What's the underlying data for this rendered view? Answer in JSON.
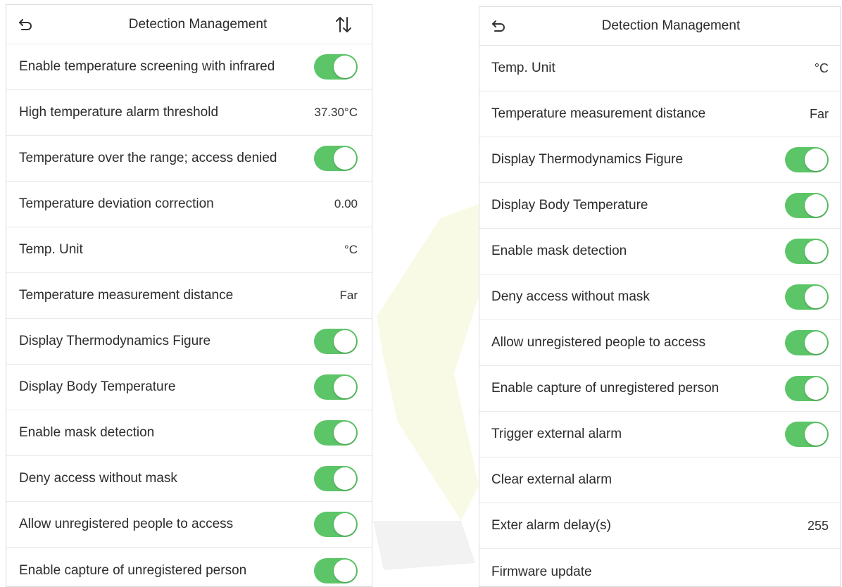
{
  "colors": {
    "toggle_on": "#5cc567",
    "divider": "#e9e9e9"
  },
  "left_screen": {
    "title": "Detection Management",
    "rows": [
      {
        "label": "Enable temperature screening with infrared",
        "type": "toggle",
        "on": true
      },
      {
        "label": "High temperature alarm threshold",
        "type": "value",
        "value": "37.30°C"
      },
      {
        "label": "Temperature over the range; access denied",
        "type": "toggle",
        "on": true
      },
      {
        "label": "Temperature deviation correction",
        "type": "value",
        "value": "0.00"
      },
      {
        "label": "Temp. Unit",
        "type": "value",
        "value": "°C"
      },
      {
        "label": "Temperature measurement distance",
        "type": "value",
        "value": "Far"
      },
      {
        "label": "Display Thermodynamics Figure",
        "type": "toggle",
        "on": true
      },
      {
        "label": "Display Body Temperature",
        "type": "toggle",
        "on": true
      },
      {
        "label": "Enable mask detection",
        "type": "toggle",
        "on": true
      },
      {
        "label": "Deny access without mask",
        "type": "toggle",
        "on": true
      },
      {
        "label": "Allow unregistered people to access",
        "type": "toggle",
        "on": true
      },
      {
        "label": "Enable capture of unregistered person",
        "type": "toggle",
        "on": true
      }
    ]
  },
  "right_screen": {
    "title": "Detection Management",
    "rows": [
      {
        "label": "Temp. Unit",
        "type": "value",
        "value": "°C"
      },
      {
        "label": "Temperature measurement distance",
        "type": "value",
        "value": "Far"
      },
      {
        "label": "Display Thermodynamics Figure",
        "type": "toggle",
        "on": true
      },
      {
        "label": "Display Body Temperature",
        "type": "toggle",
        "on": true
      },
      {
        "label": "Enable mask detection",
        "type": "toggle",
        "on": true
      },
      {
        "label": "Deny access without mask",
        "type": "toggle",
        "on": true
      },
      {
        "label": "Allow unregistered people to access",
        "type": "toggle",
        "on": true
      },
      {
        "label": "Enable capture of unregistered person",
        "type": "toggle",
        "on": true
      },
      {
        "label": "Trigger external alarm",
        "type": "toggle",
        "on": true
      },
      {
        "label": "Clear external alarm",
        "type": "none"
      },
      {
        "label": "Exter alarm delay(s)",
        "type": "value",
        "value": "255"
      },
      {
        "label": "Firmware update",
        "type": "none"
      }
    ]
  }
}
